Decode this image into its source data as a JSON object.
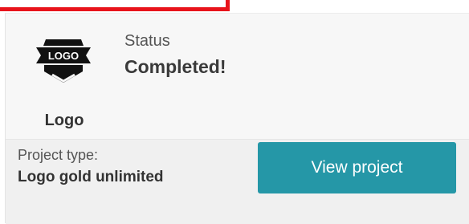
{
  "logo": {
    "badge_text": "LOGO",
    "caption": "Logo",
    "icon": "logo-badge-icon"
  },
  "status": {
    "label": "Status",
    "value": "Completed!"
  },
  "project": {
    "type_label": "Project type:",
    "type_value": "Logo gold unlimited"
  },
  "actions": {
    "view_project_label": "View project"
  },
  "colors": {
    "highlight_frame": "#e8141b",
    "primary_button": "#2597a7",
    "card_background": "#f7f7f7",
    "footer_background": "#f0f0f0"
  }
}
